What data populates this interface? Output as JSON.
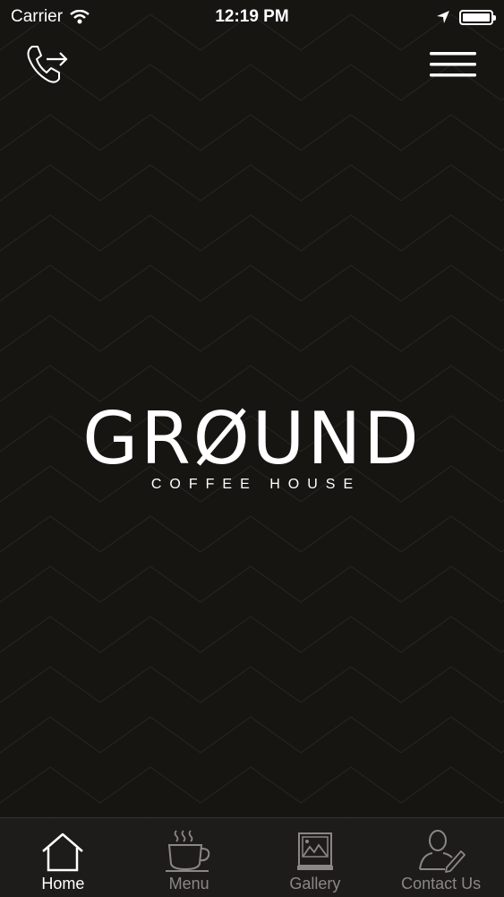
{
  "status": {
    "carrier": "Carrier",
    "time": "12:19 PM"
  },
  "header": {
    "call_icon": "phone-forward-icon",
    "menu_icon": "hamburger-menu-icon"
  },
  "logo": {
    "title": "GRØUND",
    "subtitle": "COFFEE HOUSE"
  },
  "tabs": [
    {
      "label": "Home",
      "icon": "home-icon",
      "active": true
    },
    {
      "label": "Menu",
      "icon": "coffee-cup-icon",
      "active": false
    },
    {
      "label": "Gallery",
      "icon": "gallery-icon",
      "active": false
    },
    {
      "label": "Contact Us",
      "icon": "contact-icon",
      "active": false
    }
  ],
  "colors": {
    "background": "#171512",
    "tabbar": "#1e1c1b",
    "active": "#ffffff",
    "inactive": "#8a8785"
  }
}
